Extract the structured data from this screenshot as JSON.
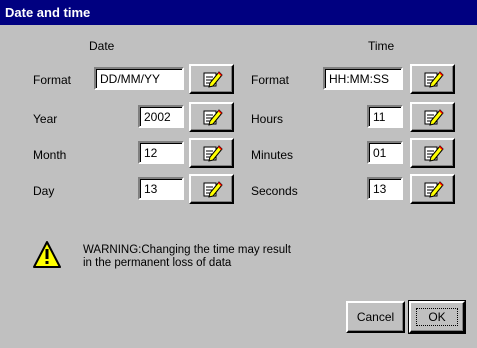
{
  "window": {
    "title": "Date and time"
  },
  "date": {
    "heading": "Date",
    "rows": [
      {
        "label": "Format",
        "value": "DD/MM/YY"
      },
      {
        "label": "Year",
        "value": "2002"
      },
      {
        "label": "Month",
        "value": "12"
      },
      {
        "label": "Day",
        "value": "13"
      }
    ]
  },
  "time": {
    "heading": "Time",
    "rows": [
      {
        "label": "Format",
        "value": "HH:MM:SS"
      },
      {
        "label": "Hours",
        "value": "11"
      },
      {
        "label": "Minutes",
        "value": "01"
      },
      {
        "label": "Seconds",
        "value": "13"
      }
    ]
  },
  "warning": {
    "icon": "warning-triangle-icon",
    "line1": "WARNING:Changing the time may result",
    "line2": "in the permanent loss of data"
  },
  "buttons": {
    "cancel": "Cancel",
    "ok": "OK"
  },
  "colors": {
    "titlebar": "#000080",
    "face": "#c0c0c0",
    "warning_yellow": "#ffff00"
  }
}
